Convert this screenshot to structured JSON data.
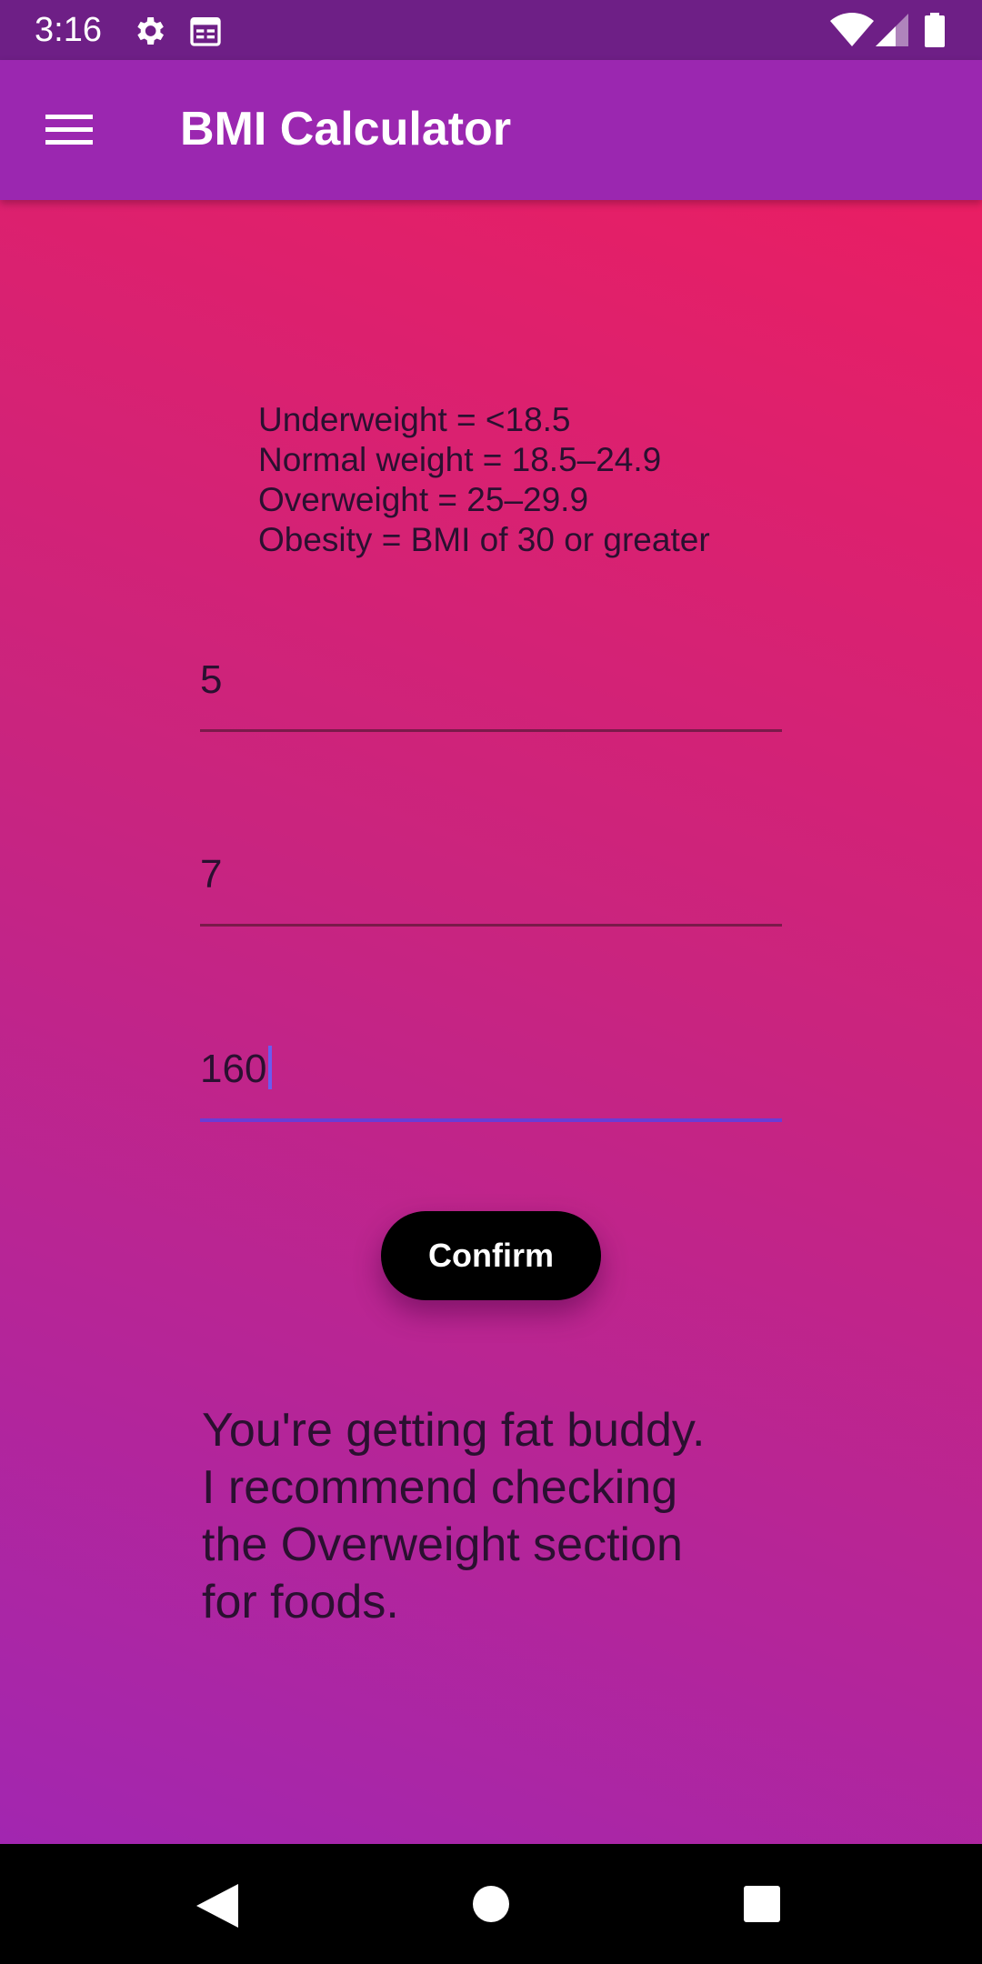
{
  "status_bar": {
    "time": "3:16",
    "icons": [
      "gear-icon",
      "calendar-icon",
      "wifi-icon",
      "signal-icon",
      "battery-icon"
    ],
    "background": "#6e1f86"
  },
  "app_bar": {
    "title": "BMI Calculator",
    "menu_icon": "hamburger-menu-icon",
    "background": "#9b27b0"
  },
  "bmi_info": {
    "lines": [
      "Underweight = <18.5",
      "Normal weight = 18.5–24.9",
      "Overweight = 25–29.9",
      "Obesity = BMI of 30 or greater"
    ]
  },
  "inputs": {
    "feet": "5",
    "inches": "7",
    "pounds": "160"
  },
  "confirm_button": {
    "label": "Confirm"
  },
  "result": {
    "lines": [
      "You're getting fat buddy.",
      "I recommend checking",
      "the Overweight section",
      "for foods."
    ]
  },
  "nav_bar": {
    "icons": [
      "back-icon",
      "home-icon",
      "recents-icon"
    ]
  },
  "colors": {
    "gradient_top": "#e91e63",
    "gradient_bottom": "#a226b0",
    "focus_underline": "#6a3cd6"
  }
}
